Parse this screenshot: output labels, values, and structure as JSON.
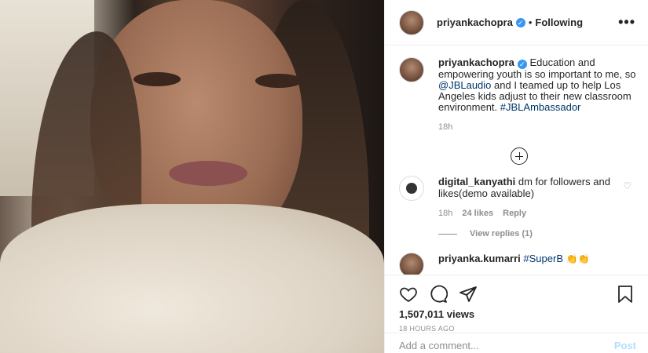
{
  "post": {
    "username": "priyankachopra",
    "separator": "•",
    "follow_status": "Following",
    "more_label": "•••"
  },
  "caption": {
    "username": "priyankachopra",
    "text_part1": "Education and empowering youth is so important to me, so",
    "mention": "@JBLaudio",
    "text_part2": "and I teamed up to help Los Angeles kids adjust to their new classroom environment.",
    "hashtag": "#JBLAmbassador",
    "time": "18h"
  },
  "comments": [
    {
      "username": "digital_kanyathi",
      "text": "dm for followers and likes(demo available)",
      "time": "18h",
      "likes": "24 likes",
      "reply_label": "Reply",
      "view_replies": "View replies (1)"
    },
    {
      "username": "priyanka.kumarri",
      "text": "#SuperB",
      "emoji": "👏👏"
    }
  ],
  "stats": {
    "views": "1,507,011 views",
    "posted_ago": "18 HOURS AGO"
  },
  "composer": {
    "placeholder": "Add a comment...",
    "post_label": "Post"
  },
  "colors": {
    "accent_blue": "#3897f0",
    "link": "#00376b",
    "muted": "#8e8e8e",
    "post_disabled": "#b2dffc"
  },
  "icons": [
    "verified-badge-icon",
    "more-options-icon",
    "add-icon",
    "heart-icon",
    "comment-icon",
    "share-icon",
    "bookmark-icon",
    "like-comment-icon"
  ]
}
